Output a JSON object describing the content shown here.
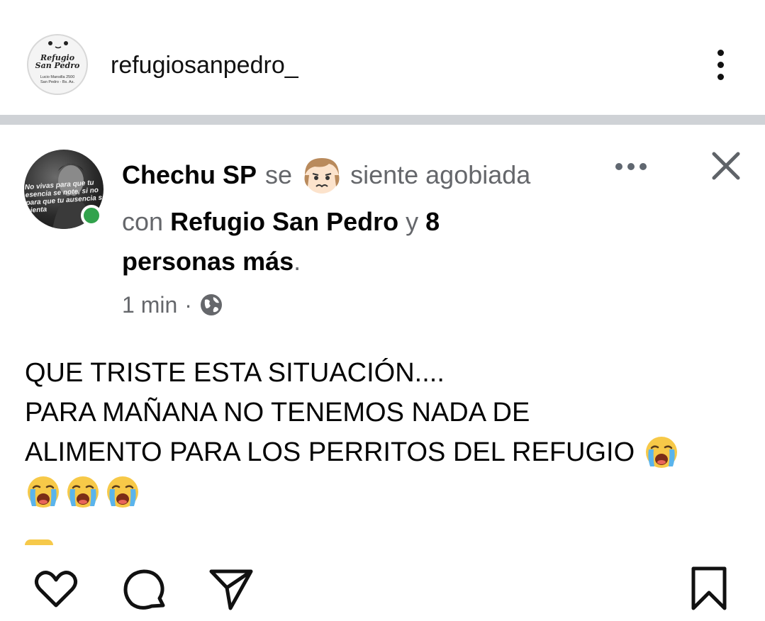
{
  "header": {
    "username": "refugiosanpedro_",
    "avatar_logo": {
      "title_line1": "Refugio",
      "title_line2": "San Pedro",
      "address_line1": "Lucio Mansilla 2500",
      "address_line2": "San Pedro - Bs. As."
    },
    "menu_icon": "more-vertical-icon"
  },
  "post": {
    "author_name": "Chechu SP",
    "feeling_prefix": "se",
    "feeling_text": "siente agobiada",
    "feeling_emoji": "overwhelmed-face-emoji",
    "with_prefix": "con",
    "tagged_page": "Refugio San Pedro",
    "and_word": "y",
    "others_count_text": "8",
    "others_text": "personas más",
    "period": ".",
    "time": "1 min",
    "separator": "·",
    "privacy_icon": "globe-icon",
    "avatar_caption": "No vivas para que tu esencia se note, si no para que tu ausencia se sienta",
    "online_color": "#31a24c",
    "body_line1": "QUE TRISTE ESTA SITUACIÓN....",
    "body_line2": "PARA MAÑANA NO TENEMOS NADA DE",
    "body_line3": "ALIMENTO PARA LOS PERRITOS DEL REFUGIO",
    "body_emoji": "loudly-crying-face-emoji",
    "body_line4_emoji_count": 3
  },
  "actions": {
    "like_icon": "heart-icon",
    "comment_icon": "comment-icon",
    "share_icon": "send-icon",
    "save_icon": "bookmark-icon"
  },
  "colors": {
    "divider": "#cfd2d6",
    "secondary_text": "#65676b",
    "primary_text": "#050505"
  }
}
